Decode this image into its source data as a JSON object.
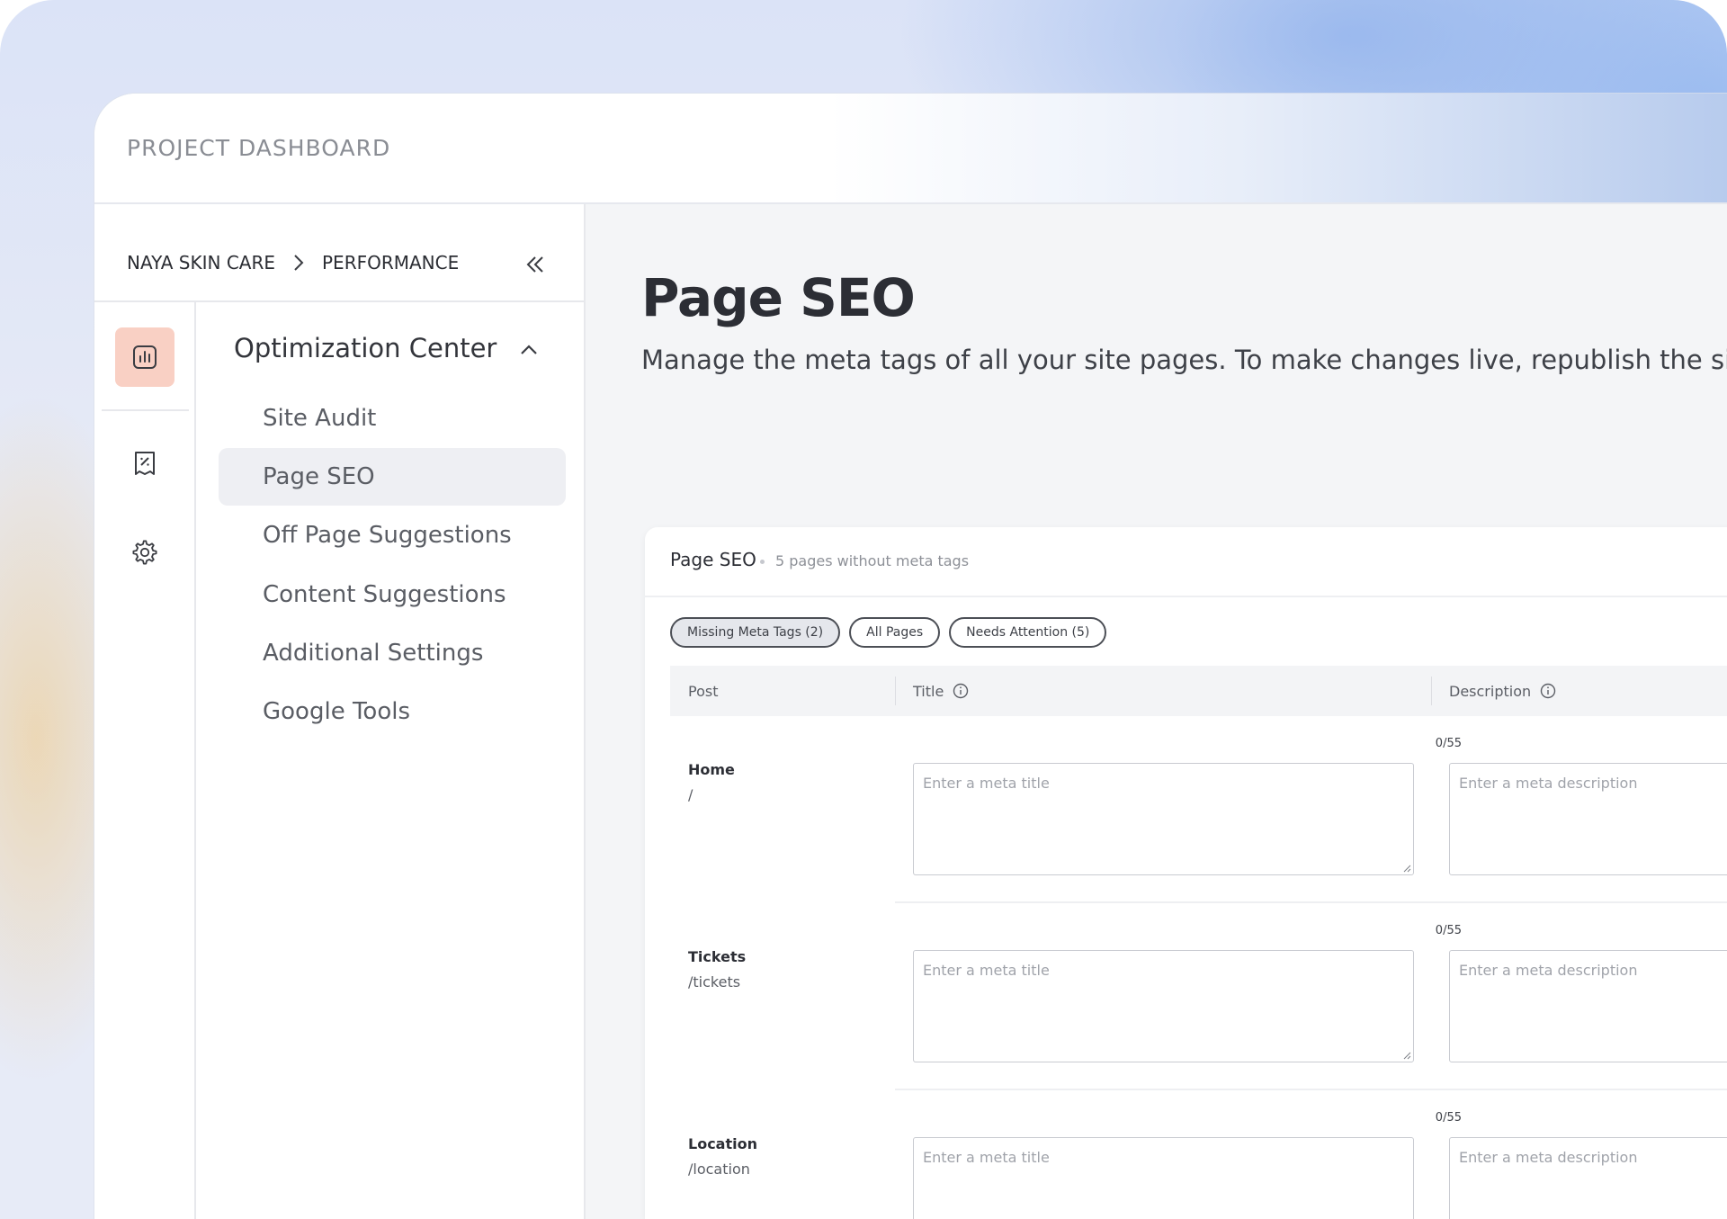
{
  "app": {
    "title": "PROJECT DASHBOARD"
  },
  "breadcrumb": {
    "items": [
      "NAYA SKIN CARE",
      "PERFORMANCE"
    ]
  },
  "sidebar": {
    "section_title": "Optimization Center",
    "items": [
      {
        "label": "Site Audit",
        "selected": false
      },
      {
        "label": "Page SEO",
        "selected": true
      },
      {
        "label": "Off Page Suggestions",
        "selected": false
      },
      {
        "label": "Content Suggestions",
        "selected": false
      },
      {
        "label": "Additional Settings",
        "selected": false
      },
      {
        "label": "Google Tools",
        "selected": false
      }
    ],
    "rail_icons": [
      "chart-icon",
      "receipt-percent-icon",
      "gear-icon"
    ]
  },
  "main": {
    "title": "Page SEO",
    "subtitle": "Manage the meta tags of all your site pages. To make changes live, republish the site. It ca"
  },
  "card": {
    "title": "Page SEO",
    "count_text": "5 pages without meta tags",
    "filters": [
      {
        "label": "Missing Meta Tags (2)",
        "active": true
      },
      {
        "label": "All Pages",
        "active": false
      },
      {
        "label": "Needs Attention (5)",
        "active": false
      }
    ],
    "columns": [
      "Post",
      "Title",
      "Description"
    ],
    "rows": [
      {
        "name": "Home",
        "path": "/",
        "counter": "0/55",
        "title_placeholder": "Enter a meta title",
        "desc_placeholder": "Enter a meta description"
      },
      {
        "name": "Tickets",
        "path": "/tickets",
        "counter": "0/55",
        "title_placeholder": "Enter a meta title",
        "desc_placeholder": "Enter a meta description"
      },
      {
        "name": "Location",
        "path": "/location",
        "counter": "0/55",
        "title_placeholder": "Enter a meta title",
        "desc_placeholder": "Enter a meta description"
      }
    ]
  },
  "colors": {
    "accent_active_rail": "#f9d0c4",
    "text_primary": "#2c2e35",
    "selected_nav_bg": "#eeeff3"
  }
}
